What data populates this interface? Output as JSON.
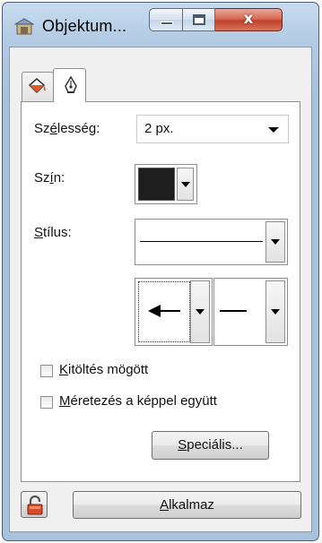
{
  "window": {
    "title": "Objektum...",
    "close_glyph": "x"
  },
  "tabs": [
    {
      "icon": "fill-bucket-icon",
      "selected": false
    },
    {
      "icon": "pen-nib-icon",
      "selected": true
    }
  ],
  "stroke": {
    "width_label_pre": "Sz",
    "width_label_accel": "é",
    "width_label_post": "lesség:",
    "width_value": "2 px.",
    "color_label_pre": "Sz",
    "color_label_accel": "í",
    "color_label_post": "n:",
    "color_value": "#1e1e1e",
    "style_label_accel": "S",
    "style_label_post": "tílus:"
  },
  "options": {
    "fill_behind_accel": "K",
    "fill_behind_post": "itöltés mögött",
    "scale_accel": "M",
    "scale_post": "éretezés a képpel együtt",
    "special_accel": "S",
    "special_post": "peciális..."
  },
  "footer": {
    "apply_accel": "A",
    "apply_post": "lkalmaz",
    "lock_icon": "unlocked-padlock-icon"
  }
}
